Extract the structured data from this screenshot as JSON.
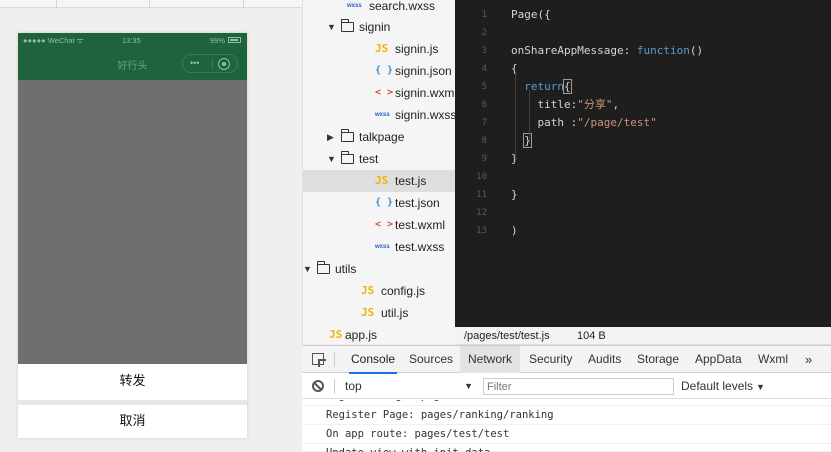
{
  "simulator": {
    "status_bar": {
      "carrier": "●●●●● WeChat ᯤ",
      "time": "13:35",
      "battery": "99%"
    },
    "nav_title": "好行头",
    "capsule_dots": "•••",
    "action_sheet": {
      "forward_label": "转发",
      "cancel_label": "取消"
    },
    "colors": {
      "navbar": "#1e633b",
      "mask": "#6f6f6f"
    }
  },
  "file_tree": {
    "partial_top": "search.wxss",
    "items": [
      {
        "kind": "folder",
        "open": true,
        "label": "signin"
      },
      {
        "kind": "file",
        "type": "JS",
        "label": "signin.js"
      },
      {
        "kind": "file",
        "type": "{}",
        "label": "signin.json"
      },
      {
        "kind": "file",
        "type": "<>",
        "label": "signin.wxml"
      },
      {
        "kind": "file",
        "type": "wxss",
        "label": "signin.wxss"
      },
      {
        "kind": "folder",
        "open": false,
        "label": "talkpage"
      },
      {
        "kind": "folder",
        "open": true,
        "label": "test"
      },
      {
        "kind": "file",
        "type": "JS",
        "label": "test.js",
        "selected": true
      },
      {
        "kind": "file",
        "type": "{}",
        "label": "test.json"
      },
      {
        "kind": "file",
        "type": "<>",
        "label": "test.wxml"
      },
      {
        "kind": "file",
        "type": "wxss",
        "label": "test.wxss"
      },
      {
        "kind": "folder",
        "open": true,
        "label": "utils"
      },
      {
        "kind": "file",
        "type": "JS",
        "label": "config.js"
      },
      {
        "kind": "file",
        "type": "JS",
        "label": "util.js"
      },
      {
        "kind": "file",
        "type": "JS",
        "label": "app.js"
      }
    ],
    "icons": {
      "folder_open_arrow": "▼",
      "folder_closed_arrow": "▶"
    }
  },
  "editor": {
    "lines": [
      {
        "n": "1",
        "code": "Page({"
      },
      {
        "n": "2",
        "code": ""
      },
      {
        "n": "3",
        "code": "onShareAppMessage: function()"
      },
      {
        "n": "4",
        "code": "{"
      },
      {
        "n": "5",
        "code": "  return{"
      },
      {
        "n": "6",
        "code": "    title:\"分享\","
      },
      {
        "n": "7",
        "code": "    path :\"/page/test\""
      },
      {
        "n": "8",
        "code": "  }"
      },
      {
        "n": "9",
        "code": "}"
      },
      {
        "n": "10",
        "code": ""
      },
      {
        "n": "11",
        "code": "}"
      },
      {
        "n": "12",
        "code": ""
      },
      {
        "n": "13",
        "code": ")"
      }
    ],
    "file_path": "/pages/test/test.js",
    "file_size": "104 B"
  },
  "devtools": {
    "tabs": [
      "Console",
      "Sources",
      "Network",
      "Security",
      "Audits",
      "Storage",
      "AppData",
      "Wxml"
    ],
    "more": "»",
    "context": "top",
    "filter_placeholder": "Filter",
    "levels": "Default levels",
    "console_lines": [
      "Register Page: pages/search/search",
      "Register Page: pages/ranking/ranking",
      "On app route: pages/test/test",
      "Update view with init data"
    ]
  }
}
